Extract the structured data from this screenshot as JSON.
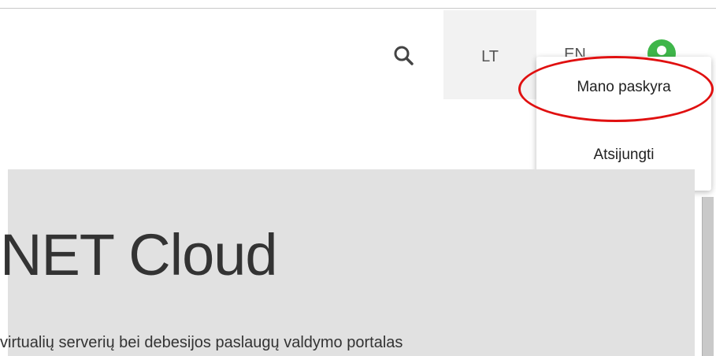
{
  "header": {
    "languages": [
      {
        "code": "LT",
        "active": true
      },
      {
        "code": "EN",
        "active": false
      }
    ],
    "icons": {
      "search": "search-icon",
      "user": "user-icon"
    },
    "user_menu": {
      "items": [
        {
          "label": "Mano paskyra"
        },
        {
          "label": "Atsijungti"
        }
      ]
    }
  },
  "hero": {
    "title": "NET Cloud",
    "subtitle": "virtualių serverių bei debesijos paslaugų valdymo portalas"
  },
  "colors": {
    "accent_green": "#3fb64a",
    "highlight_red": "#e01010",
    "hero_bg": "#e1e1e1"
  }
}
